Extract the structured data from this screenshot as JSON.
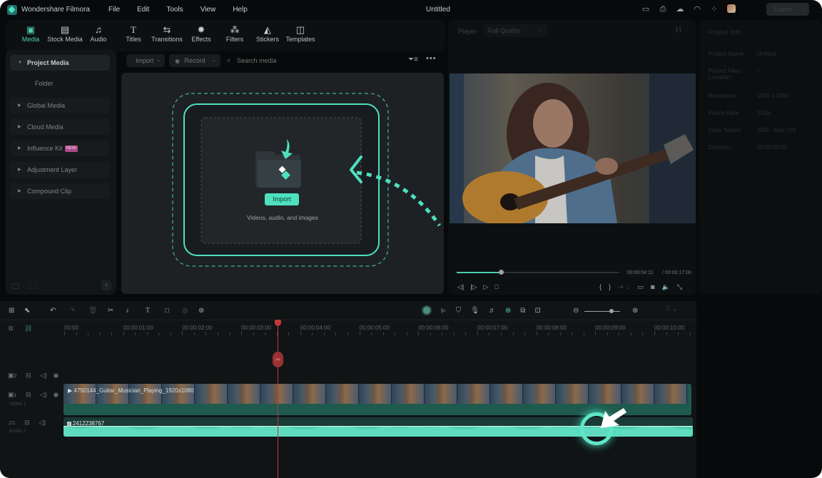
{
  "app": {
    "name": "Wondershare Filmora",
    "window_title": "Untitled",
    "export_label": "Export"
  },
  "menu": [
    "File",
    "Edit",
    "Tools",
    "View",
    "Help"
  ],
  "titlebar_icons": [
    "layout-icon",
    "save-icon",
    "cloud-upload-icon",
    "headset-icon",
    "apps-grid-icon",
    "user-avatar"
  ],
  "tabs": [
    {
      "label": "Media",
      "icon": "media-icon",
      "active": true
    },
    {
      "label": "Stock Media",
      "icon": "stock-media-icon"
    },
    {
      "label": "Audio",
      "icon": "music-note-icon"
    },
    {
      "label": "Titles",
      "icon": "text-icon"
    },
    {
      "label": "Transitions",
      "icon": "transition-icon"
    },
    {
      "label": "Effects",
      "icon": "effects-icon"
    },
    {
      "label": "Filters",
      "icon": "filters-icon"
    },
    {
      "label": "Stickers",
      "icon": "stickers-icon"
    },
    {
      "label": "Templates",
      "icon": "templates-icon"
    }
  ],
  "sidebar": {
    "items": [
      {
        "label": "Project Media",
        "expanded": true
      },
      {
        "label": "Folder",
        "sub": true
      },
      {
        "label": "Global Media"
      },
      {
        "label": "Cloud Media"
      },
      {
        "label": "Influence Kit",
        "badge": "NEW"
      },
      {
        "label": "Adjustment Layer"
      },
      {
        "label": "Compound Clip"
      }
    ]
  },
  "media": {
    "import_label": "Import",
    "record_label": "Record",
    "search_placeholder": "Search media",
    "drop_button": "Import",
    "drop_hint": "Videos, audio, and images"
  },
  "player": {
    "label": "Player",
    "quality": "Full Quality",
    "current_time": "00:00:04:11",
    "total_time": "/ 00:00:17:00",
    "progress": 0.27
  },
  "project_info": {
    "title": "Project Info",
    "rows": [
      {
        "label": "Project Name:",
        "value": "Untitled"
      },
      {
        "label": "Project Files Location:",
        "value": "/"
      },
      {
        "label": "Resolution:",
        "value": "1920 x 1080"
      },
      {
        "label": "Frame Rate:",
        "value": "25fps"
      },
      {
        "label": "Color Space:",
        "value": "SDR - Rec.709"
      },
      {
        "label": "Duration:",
        "value": "00:00:00:00"
      }
    ]
  },
  "timeline": {
    "ruler": [
      "00:00",
      "00:00:01:00",
      "00:00:02:00",
      "00:00:03:00",
      "00:00:04:00",
      "00:00:05:00",
      "00:00:06:00",
      "00:00:07:00",
      "00:00:08:00",
      "00:00:09:00",
      "00:00:10:00"
    ],
    "zoom_level": 0.75,
    "tracks": [
      {
        "id": "2",
        "name": ""
      },
      {
        "id": "1",
        "name": "Video 1",
        "clip": "4750144_Guitar_Musician_Playing_1920x1080"
      },
      {
        "id": "1",
        "name": "Audio 1",
        "clip": "2412238767"
      }
    ]
  },
  "colors": {
    "accent": "#4ecdb0",
    "playhead": "#c0383c",
    "badge": "#b04a8c"
  }
}
